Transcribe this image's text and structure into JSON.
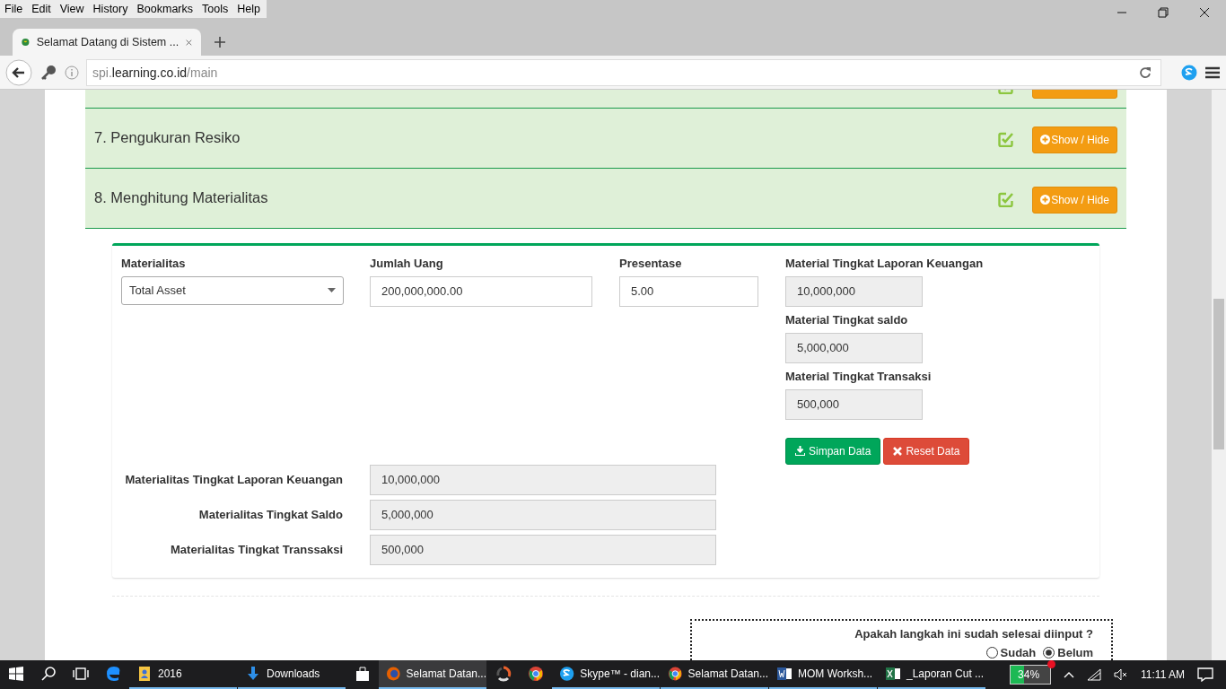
{
  "menu_bar": [
    "File",
    "Edit",
    "View",
    "History",
    "Bookmarks",
    "Tools",
    "Help"
  ],
  "tab": {
    "title": "Selamat Datang di Sistem ..."
  },
  "address": {
    "prefix": "spi.",
    "domain": "learning.co.id",
    "path": "/main"
  },
  "sections": [
    {
      "done": true,
      "kind": "partial"
    },
    {
      "title": "7. Pengukuran Resiko",
      "done": true,
      "kind": "full",
      "button": "Show / Hide"
    },
    {
      "title": "8. Menghitung Materialitas",
      "done": true,
      "kind": "full",
      "button": "Show / Hide"
    }
  ],
  "form": {
    "materialitas": {
      "label": "Materialitas",
      "value": "Total Asset"
    },
    "jumlah": {
      "label": "Jumlah Uang",
      "value": "200,000,000.00",
      "readonly": false
    },
    "presentase": {
      "label": "Presentase",
      "value": "5.00",
      "readonly": false
    },
    "results": [
      {
        "label": "Material Tingkat Laporan Keuangan",
        "value": "10,000,000",
        "readonly": true
      },
      {
        "label": "Material Tingkat saldo",
        "value": "5,000,000",
        "readonly": true
      },
      {
        "label": "Material Tingkat Transaksi",
        "value": "500,000",
        "readonly": true
      }
    ],
    "save_button": "Simpan Data",
    "reset_button": "Reset Data"
  },
  "summary": [
    {
      "label": "Materialitas Tingkat Laporan Keuangan",
      "value": "10,000,000",
      "readonly": true
    },
    {
      "label": "Materialitas Tingkat Saldo",
      "value": "5,000,000",
      "readonly": true
    },
    {
      "label": "Materialitas Tingkat Transsaksi",
      "value": "500,000",
      "readonly": true
    }
  ],
  "question": {
    "text": "Apakah langkah ini sudah selesai diinput ?",
    "options": [
      {
        "label": "Sudah",
        "selected": false
      },
      {
        "label": "Belum",
        "selected": true
      }
    ]
  },
  "taskbar": {
    "items": [
      {
        "kind": "start"
      },
      {
        "kind": "search"
      },
      {
        "kind": "taskview"
      },
      {
        "kind": "edge"
      },
      {
        "kind": "folder",
        "label": "2016",
        "running": true,
        "selected": false
      },
      {
        "kind": "download",
        "label": "Downloads",
        "running": true,
        "selected": false
      },
      {
        "kind": "store"
      },
      {
        "kind": "firefox",
        "label": "Selamat Datan...",
        "running": true,
        "selected": true
      },
      {
        "kind": "ring"
      },
      {
        "kind": "chrome"
      },
      {
        "kind": "skype",
        "label": "Skype™ - dian...",
        "running": true,
        "selected": false
      },
      {
        "kind": "chrome",
        "label": "Selamat Datan...",
        "running": true,
        "selected": false
      },
      {
        "kind": "word",
        "label": "MOM Worksh...",
        "running": true,
        "selected": false
      },
      {
        "kind": "excel",
        "label": "_Laporan Cut ...",
        "running": true,
        "selected": false
      }
    ],
    "battery": {
      "text": "34%",
      "level": 0.34
    },
    "time": "11:11 AM"
  }
}
